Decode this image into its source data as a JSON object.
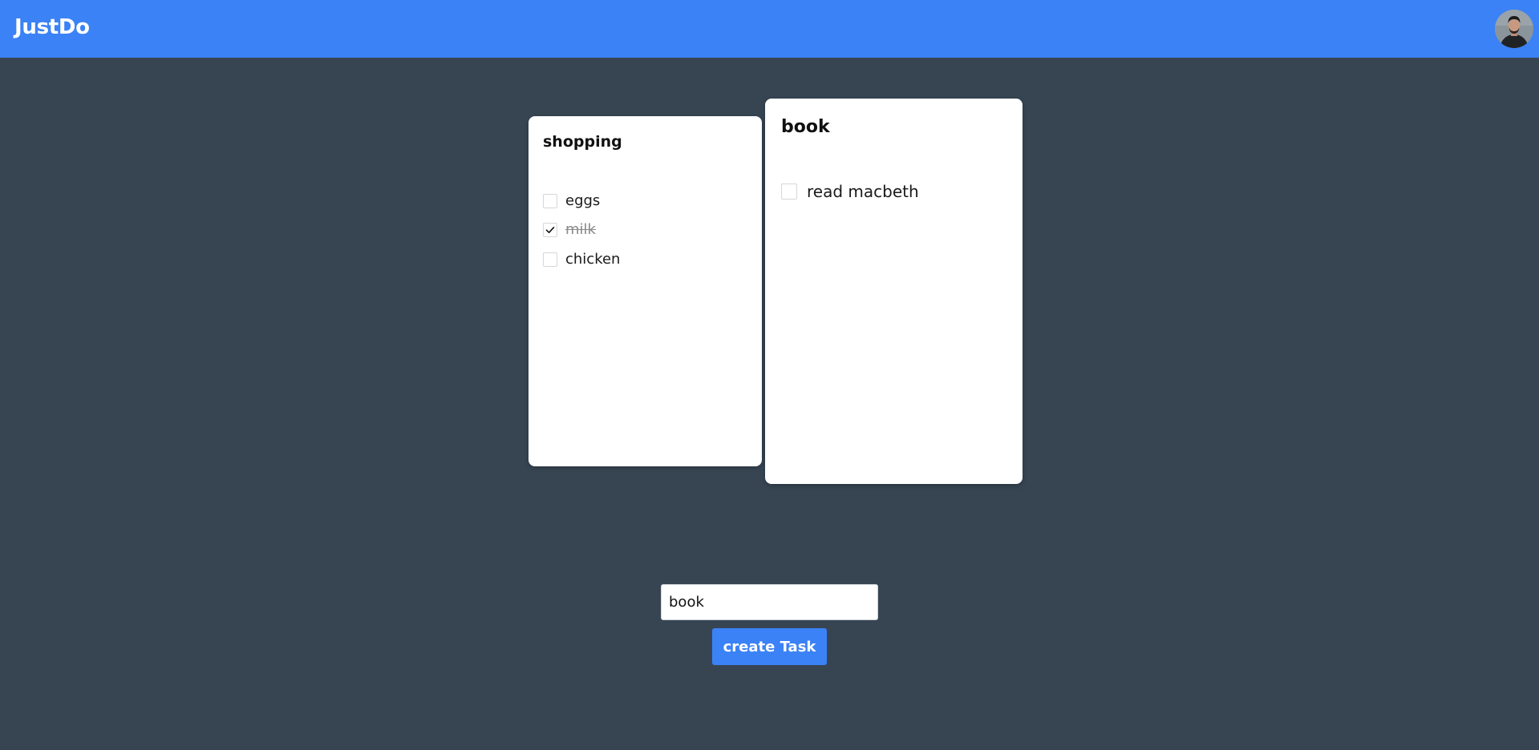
{
  "header": {
    "brand": "JustDo",
    "brand_color": "#3b82f6",
    "avatar_icon": "user-avatar"
  },
  "lists": [
    {
      "title": "shopping",
      "tasks": [
        {
          "label": "eggs",
          "done": false
        },
        {
          "label": "milk",
          "done": true
        },
        {
          "label": "chicken",
          "done": false
        }
      ]
    },
    {
      "title": "book",
      "tasks": [
        {
          "label": "read macbeth",
          "done": false
        }
      ]
    }
  ],
  "form": {
    "input_value": "book",
    "button_label": "create Task"
  },
  "colors": {
    "background": "#374553",
    "accent": "#3b82f6",
    "card": "#ffffff"
  }
}
